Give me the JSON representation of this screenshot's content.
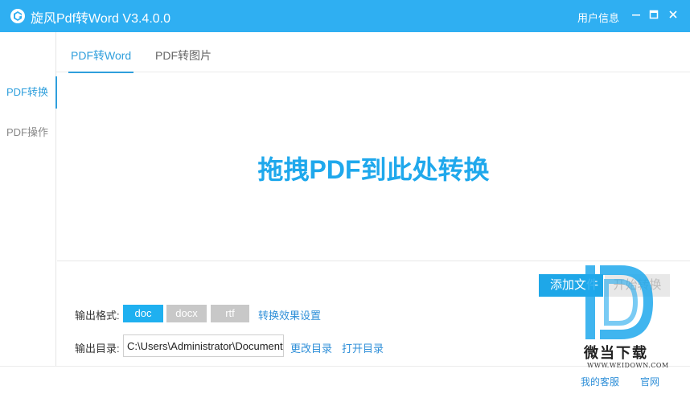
{
  "titlebar": {
    "title": "旋风Pdf转Word  V3.4.0.0",
    "user_info": "用户信息",
    "logo_icon": "app-logo-icon",
    "color": "#2faff2"
  },
  "sidebar": {
    "items": [
      {
        "label": "PDF转换",
        "active": true
      },
      {
        "label": "PDF操作",
        "active": false
      }
    ]
  },
  "tabs": [
    {
      "label": "PDF转Word",
      "active": true
    },
    {
      "label": "PDF转图片",
      "active": false
    }
  ],
  "dropzone": {
    "text": "拖拽PDF到此处转换"
  },
  "actions": {
    "add_file": "添加文件",
    "start": "开始转换"
  },
  "output_format": {
    "label": "输出格式:",
    "options": [
      "doc",
      "docx",
      "rtf"
    ],
    "selected": "doc",
    "settings_link": "转换效果设置"
  },
  "output_dir": {
    "label": "输出目录:",
    "value": "C:\\Users\\Administrator\\Documents",
    "change_link": "更改目录",
    "open_link": "打开目录"
  },
  "footer": {
    "support": "我的客服",
    "website": "官网"
  },
  "watermark": {
    "text": "微当下载",
    "url": "WWW.WEIDOWN.COM"
  },
  "colors": {
    "accent": "#1fa8ec",
    "link": "#2f8fd8",
    "disabled": "#c8c8c8"
  }
}
